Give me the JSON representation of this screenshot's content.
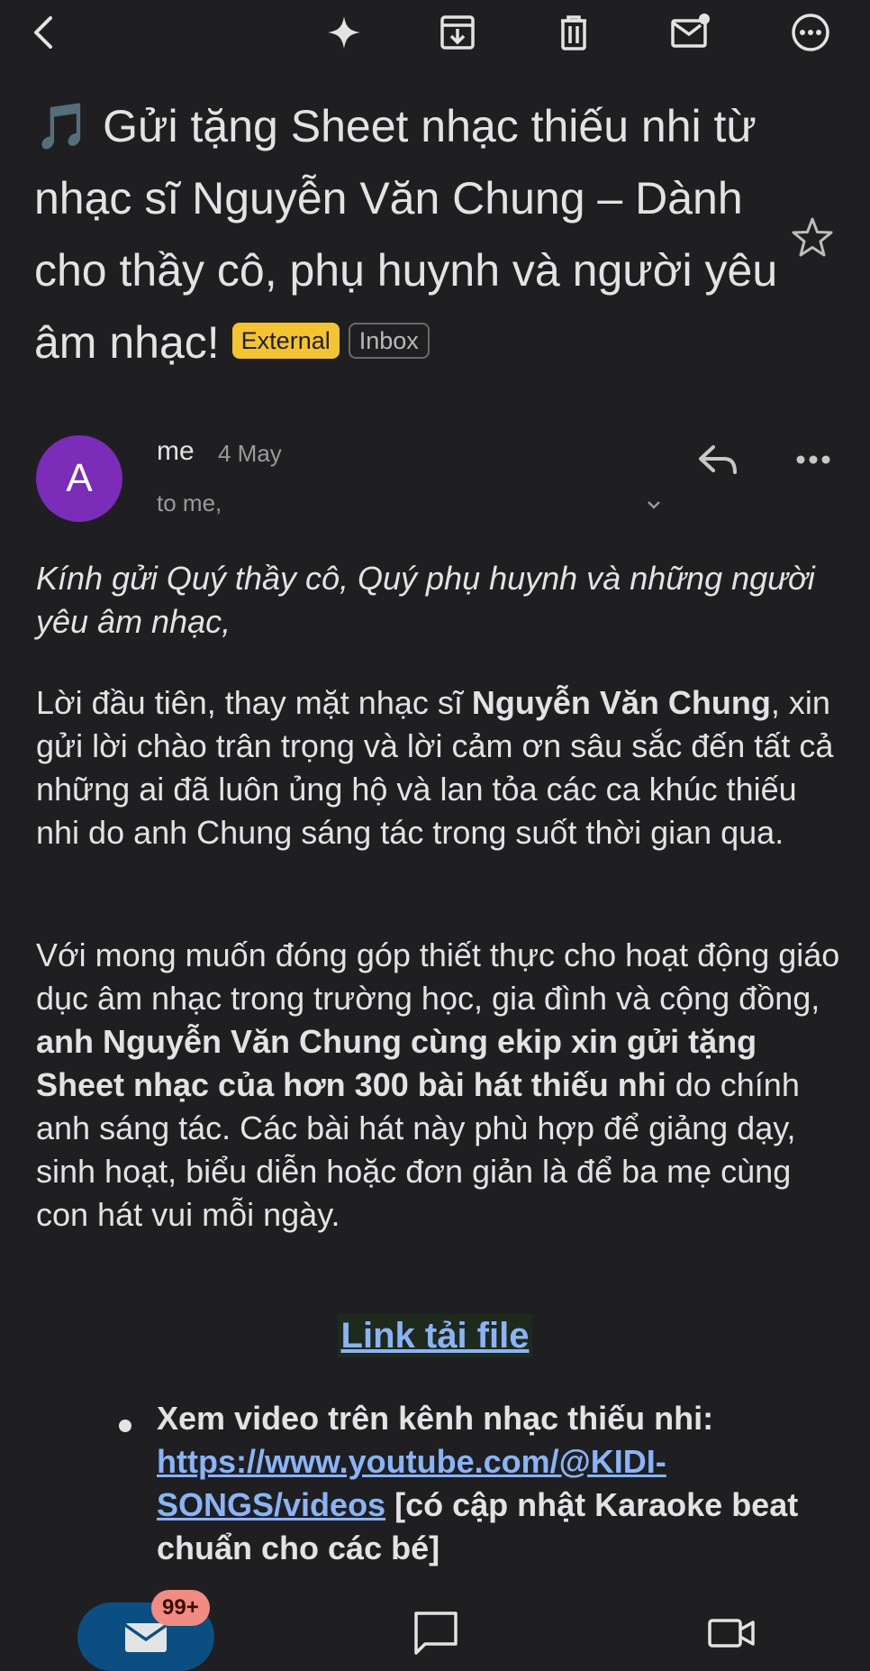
{
  "topbar": {
    "icons": [
      "back-arrow-icon",
      "sparkle-icon",
      "archive-icon",
      "trash-icon",
      "mark-unread-icon",
      "more-options-icon"
    ]
  },
  "subject": {
    "note": "🎵",
    "text": " Gửi tặng Sheet nhạc thiếu nhi từ nhạc sĩ Nguyễn Văn Chung – Dành cho thầy cô, phụ huynh và người yêu âm nhạc!",
    "labels": {
      "external": "External",
      "inbox": "Inbox"
    }
  },
  "message": {
    "avatar_letter": "A",
    "avatar_color": "#7b2cb8",
    "sender": "me",
    "date": "4 May",
    "to": "to me,"
  },
  "body": {
    "greeting": "Kính gửi Quý thầy cô, Quý phụ huynh và những người yêu âm nhạc,",
    "p2_a": "Lời đầu tiên, thay mặt nhạc sĩ ",
    "p2_bold": "Nguyễn Văn Chung",
    "p2_b": ", xin gửi lời chào trân trọng và lời cảm ơn sâu sắc đến tất cả những ai đã luôn ủng hộ và lan tỏa các ca khúc thiếu nhi do anh Chung sáng tác trong suốt thời gian qua.",
    "p3_a": "Với mong muốn đóng góp thiết thực cho hoạt động giáo dục âm nhạc trong trường học, gia đình và cộng đồng, ",
    "p3_bold": "anh Nguyễn Văn Chung cùng ekip xin gửi tặng Sheet nhạc của hơn 300 bài hát thiếu nhi",
    "p3_b": " do chính anh sáng tác. Các bài hát này phù hợp để giảng dạy, sinh hoạt, biểu diễn hoặc đơn giản là để ba mẹ cùng con hát vui mỗi ngày.",
    "download_link": "Link tải file",
    "bullet_a": "Xem video trên kênh nhạc thiếu nhi: ",
    "bullet_link": "https://www.youtube.com/@KIDI-SONGS/videos",
    "bullet_b": " [có cập nhật Karaoke beat chuẩn cho các bé]"
  },
  "bottom_nav": {
    "mail_badge": "99+",
    "accent": "#0b4f82",
    "badge_color": "#f28b82"
  }
}
